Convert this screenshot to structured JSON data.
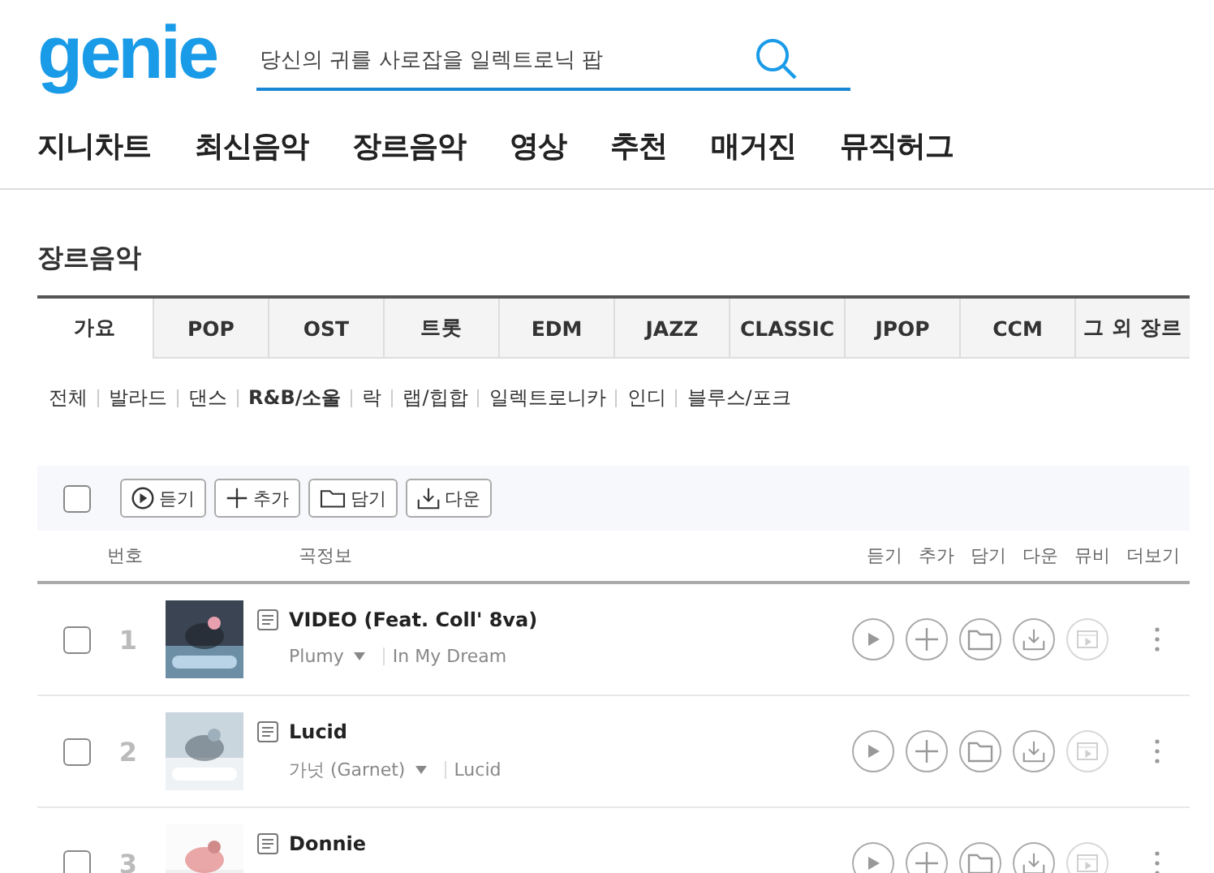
{
  "logo": "genie",
  "search": {
    "value": "당신의 귀를 사로잡을 일렉트로닉 팝"
  },
  "nav": [
    "지니차트",
    "최신음악",
    "장르음악",
    "영상",
    "추천",
    "매거진",
    "뮤직허그"
  ],
  "section_title": "장르음악",
  "genre_tabs": [
    {
      "label": "가요",
      "selected": true
    },
    {
      "label": "POP",
      "selected": false
    },
    {
      "label": "OST",
      "selected": false
    },
    {
      "label": "트롯",
      "selected": false
    },
    {
      "label": "EDM",
      "selected": false
    },
    {
      "label": "JAZZ",
      "selected": false
    },
    {
      "label": "CLASSIC",
      "selected": false
    },
    {
      "label": "JPOP",
      "selected": false
    },
    {
      "label": "CCM",
      "selected": false
    },
    {
      "label": "그 외 장르",
      "selected": false
    }
  ],
  "subgenres": [
    {
      "label": "전체",
      "selected": false
    },
    {
      "label": "발라드",
      "selected": false
    },
    {
      "label": "댄스",
      "selected": false
    },
    {
      "label": "R&B/소울",
      "selected": true
    },
    {
      "label": "락",
      "selected": false
    },
    {
      "label": "랩/힙합",
      "selected": false
    },
    {
      "label": "일렉트로니카",
      "selected": false
    },
    {
      "label": "인디",
      "selected": false
    },
    {
      "label": "블루스/포크",
      "selected": false
    }
  ],
  "toolbar": {
    "select_all_checked": false,
    "buttons": [
      {
        "kind": "play",
        "label": "듣기"
      },
      {
        "kind": "add",
        "label": "추가"
      },
      {
        "kind": "folder",
        "label": "담기"
      },
      {
        "kind": "download",
        "label": "다운"
      }
    ]
  },
  "columns": {
    "number": "번호",
    "info": "곡정보",
    "actions": [
      "듣기",
      "추가",
      "담기",
      "다운",
      "뮤비",
      "더보기"
    ]
  },
  "rows": [
    {
      "number": "1",
      "title": "VIDEO (Feat. Coll' 8va)",
      "artist": "Plumy",
      "album": "In My Dream",
      "checked": false,
      "mv_disabled": true
    },
    {
      "number": "2",
      "title": "Lucid",
      "artist": "가넛 (Garnet)",
      "album": "Lucid",
      "checked": false,
      "mv_disabled": true
    },
    {
      "number": "3",
      "title": "Donnie",
      "checked": false,
      "mv_disabled": true
    }
  ]
}
